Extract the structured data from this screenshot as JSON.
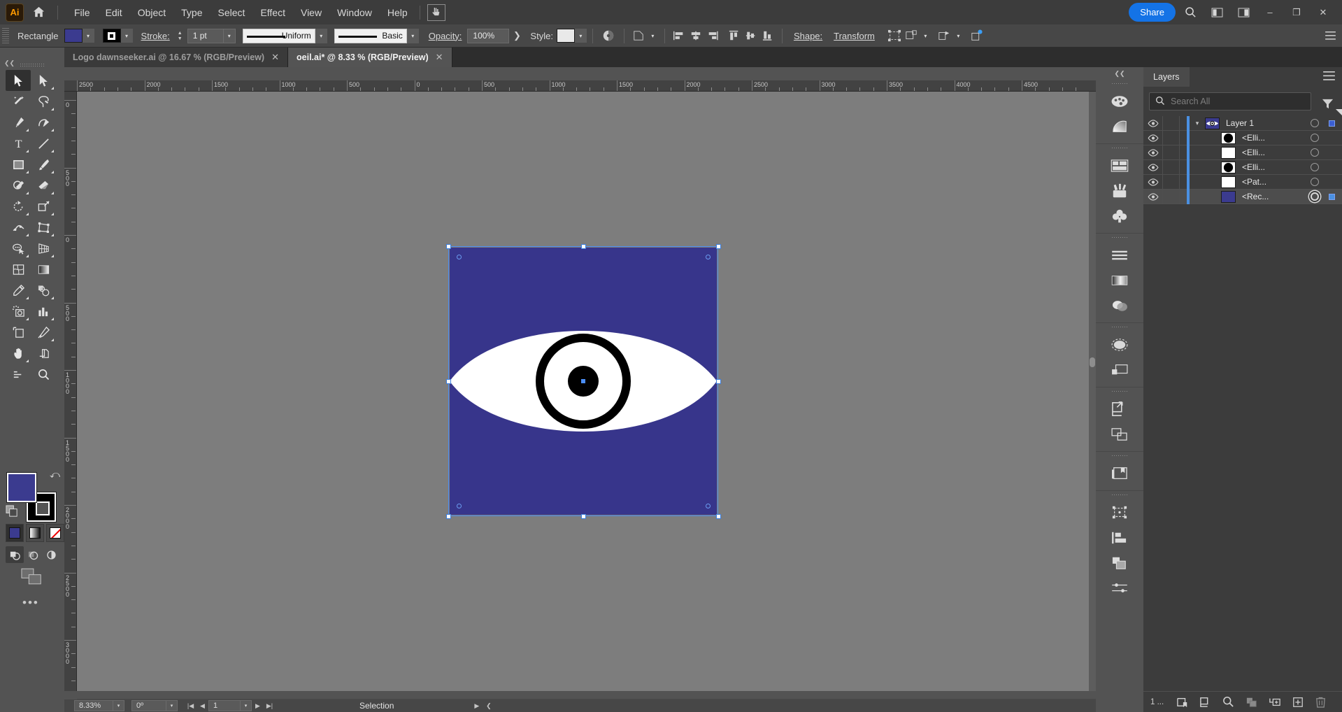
{
  "app": {
    "name": "Adobe Illustrator",
    "logo_text": "Ai"
  },
  "menubar": {
    "items": [
      "File",
      "Edit",
      "Object",
      "Type",
      "Select",
      "Effect",
      "View",
      "Window",
      "Help"
    ],
    "share_label": "Share",
    "icons": [
      "home-icon",
      "touch-cursor-icon",
      "search-icon",
      "arrange-documents-icon",
      "workspace-switcher-icon"
    ],
    "window_controls": [
      "minimize",
      "maximize",
      "close"
    ]
  },
  "controlbar": {
    "object_type": "Rectangle",
    "fill_color": "#3B3B8F",
    "stroke_color": "#000000",
    "stroke_label": "Stroke:",
    "stroke_weight": "1 pt",
    "stroke_profile_variable": "Uniform",
    "brush_definition": "Basic",
    "opacity_label": "Opacity:",
    "opacity_value": "100%",
    "style_label": "Style:",
    "shape_label": "Shape:",
    "transform_label": "Transform",
    "icons": [
      "opacity-mask-icon",
      "recolor-artwork-icon",
      "align-left-icon",
      "align-center-h-icon",
      "align-right-icon",
      "align-top-icon",
      "align-center-v-icon",
      "align-bottom-icon",
      "isolate-selection-icon",
      "group-selection-icon",
      "edit-toolbar-icon",
      "export-selection-icon",
      "document-setup-icon",
      "preferences-icon",
      "menu-icon"
    ]
  },
  "tabs": [
    {
      "title": "Logo dawnseeker.ai @ 16.67 % (RGB/Preview)",
      "active": false,
      "closable": true
    },
    {
      "title": "oeil.ai* @ 8.33 % (RGB/Preview)",
      "active": true,
      "closable": true
    }
  ],
  "toolbar": {
    "tools": [
      {
        "name": "selection-tool",
        "glyph": "arrow-solid",
        "selected": true,
        "has_flyout": false
      },
      {
        "name": "direct-selection-tool",
        "glyph": "arrow-hollow",
        "selected": false,
        "has_flyout": true
      },
      {
        "name": "magic-wand-tool",
        "glyph": "wand",
        "selected": false,
        "has_flyout": false
      },
      {
        "name": "lasso-tool",
        "glyph": "lasso",
        "selected": false,
        "has_flyout": false
      },
      {
        "name": "pen-tool",
        "glyph": "pen",
        "selected": false,
        "has_flyout": true
      },
      {
        "name": "curvature-tool",
        "glyph": "curvature",
        "selected": false,
        "has_flyout": true
      },
      {
        "name": "type-tool",
        "glyph": "type-T",
        "selected": false,
        "has_flyout": true
      },
      {
        "name": "line-segment-tool",
        "glyph": "line",
        "selected": false,
        "has_flyout": true
      },
      {
        "name": "rectangle-tool",
        "glyph": "rectangle",
        "selected": false,
        "has_flyout": true
      },
      {
        "name": "paintbrush-tool",
        "glyph": "paintbrush",
        "selected": false,
        "has_flyout": true
      },
      {
        "name": "shaper-tool",
        "glyph": "shaper",
        "selected": false,
        "has_flyout": true
      },
      {
        "name": "eraser-tool",
        "glyph": "eraser",
        "selected": false,
        "has_flyout": true
      },
      {
        "name": "rotate-tool",
        "glyph": "rotate",
        "selected": false,
        "has_flyout": true
      },
      {
        "name": "scale-tool",
        "glyph": "scale",
        "selected": false,
        "has_flyout": true
      },
      {
        "name": "width-tool",
        "glyph": "width",
        "selected": false,
        "has_flyout": true
      },
      {
        "name": "free-transform-tool",
        "glyph": "free-transform",
        "selected": false,
        "has_flyout": true
      },
      {
        "name": "shape-builder-tool",
        "glyph": "shape-builder",
        "selected": false,
        "has_flyout": true
      },
      {
        "name": "perspective-grid-tool",
        "glyph": "perspective-grid",
        "selected": false,
        "has_flyout": true
      },
      {
        "name": "mesh-tool",
        "glyph": "mesh",
        "selected": false,
        "has_flyout": false
      },
      {
        "name": "gradient-tool",
        "glyph": "gradient",
        "selected": false,
        "has_flyout": false
      },
      {
        "name": "eyedropper-tool",
        "glyph": "eyedropper",
        "selected": false,
        "has_flyout": true
      },
      {
        "name": "blend-tool",
        "glyph": "blend",
        "selected": false,
        "has_flyout": true
      },
      {
        "name": "symbol-sprayer-tool",
        "glyph": "symbol-sprayer",
        "selected": false,
        "has_flyout": true
      },
      {
        "name": "column-graph-tool",
        "glyph": "bar-chart",
        "selected": false,
        "has_flyout": true
      },
      {
        "name": "artboard-tool",
        "glyph": "artboard",
        "selected": false,
        "has_flyout": false
      },
      {
        "name": "slice-tool",
        "glyph": "slice",
        "selected": false,
        "has_flyout": true
      },
      {
        "name": "hand-tool",
        "glyph": "hand",
        "selected": false,
        "has_flyout": true
      },
      {
        "name": "print-tiling-tool",
        "glyph": "print-tiling",
        "selected": false,
        "has_flyout": false
      },
      {
        "name": "zoom-tool",
        "glyph": "magnifier",
        "selected": false,
        "has_flyout": false
      }
    ],
    "fill_color": "#3B3B8F",
    "stroke_color": "#000000",
    "color_modes": [
      {
        "name": "color-mode-button",
        "selected": true
      },
      {
        "name": "gradient-mode-button",
        "selected": false
      },
      {
        "name": "none-mode-button",
        "selected": false
      }
    ],
    "draw_modes": [
      {
        "name": "draw-normal-button",
        "selected": true
      },
      {
        "name": "draw-behind-button",
        "selected": false
      },
      {
        "name": "draw-inside-button",
        "selected": false
      }
    ],
    "screen_mode": "change-screen-mode-button",
    "more_label": "•••"
  },
  "rulers": {
    "horizontal_ticks": [
      "2500",
      "2000",
      "1500",
      "1000",
      "500",
      "0",
      "500",
      "1000",
      "1500",
      "2000",
      "2500",
      "3000",
      "3500",
      "4000",
      "4500"
    ],
    "vertical_ticks": [
      "0",
      "500",
      "0",
      "500",
      "1000",
      "1500",
      "2000",
      "2500",
      "3000"
    ],
    "unit": "px"
  },
  "artwork": {
    "name": "eye-logo-artboard",
    "background_color": "#37358B",
    "sclera_color": "#FFFFFF",
    "iris_ring_color": "#000000",
    "pupil_color": "#000000",
    "selection_color": "#4A8DF5"
  },
  "statusbar": {
    "zoom": "8.33%",
    "rotation": "0º",
    "artboard_number": "1",
    "status_text": "Selection",
    "nav_icons": [
      "first-artboard-icon",
      "previous-artboard-icon",
      "next-artboard-icon",
      "last-artboard-icon"
    ]
  },
  "icondock": {
    "groups": [
      {
        "icons": [
          "color-palette-icon",
          "color-guide-icon"
        ]
      },
      {
        "icons": [
          "properties-icon",
          "brushes-icon",
          "symbols-icon"
        ]
      },
      {
        "icons": [
          "align-icon",
          "gradient-icon",
          "transparency-icon"
        ]
      },
      {
        "icons": [
          "appearance-icon",
          "layers-thumbnail-icon"
        ]
      },
      {
        "icons": [
          "asset-export-icon",
          "artboards-icon"
        ]
      },
      {
        "icons": [
          "libraries-icon"
        ]
      },
      {
        "icons": [
          "transform-icon",
          "pathfinder-icon",
          "layers-stack-icon",
          "image-trace-icon"
        ]
      }
    ]
  },
  "layers_panel": {
    "tab_label": "Layers",
    "search_placeholder": "Search All",
    "search_value": "",
    "rows": [
      {
        "name": "Layer 1",
        "thumb_type": "eye-logo",
        "thumb_color": "#3B3B8F",
        "visible": true,
        "locked": false,
        "expanded": true,
        "indent": 0,
        "selected": false,
        "target_active": false,
        "has_color_square": true,
        "square_color": "#3B5ED1"
      },
      {
        "name": "<Elli...",
        "thumb_type": "circle",
        "thumb_color": "#000000",
        "visible": true,
        "locked": false,
        "expanded": false,
        "indent": 1,
        "selected": false,
        "target_active": false,
        "has_color_square": false,
        "square_color": ""
      },
      {
        "name": "<Elli...",
        "thumb_type": "square",
        "thumb_color": "#FFFFFF",
        "visible": true,
        "locked": false,
        "expanded": false,
        "indent": 1,
        "selected": false,
        "target_active": false,
        "has_color_square": false,
        "square_color": ""
      },
      {
        "name": "<Elli...",
        "thumb_type": "circle",
        "thumb_color": "#000000",
        "visible": true,
        "locked": false,
        "expanded": false,
        "indent": 1,
        "selected": false,
        "target_active": false,
        "has_color_square": false,
        "square_color": ""
      },
      {
        "name": "<Pat...",
        "thumb_type": "square",
        "thumb_color": "#FFFFFF",
        "visible": true,
        "locked": false,
        "expanded": false,
        "indent": 1,
        "selected": false,
        "target_active": false,
        "has_color_square": false,
        "square_color": ""
      },
      {
        "name": "<Rec...",
        "thumb_type": "square",
        "thumb_color": "#3B3B8F",
        "visible": true,
        "locked": false,
        "expanded": false,
        "indent": 1,
        "selected": true,
        "target_active": true,
        "has_color_square": true,
        "square_color": "#4A90E2"
      }
    ],
    "footer": {
      "count_label": "1 ...",
      "icons": [
        "locate-object-icon",
        "release-to-layers-icon",
        "find-icon",
        "collect-in-new-layer-icon",
        "create-sublayer-icon",
        "create-new-layer-icon",
        "delete-selection-icon"
      ]
    }
  }
}
